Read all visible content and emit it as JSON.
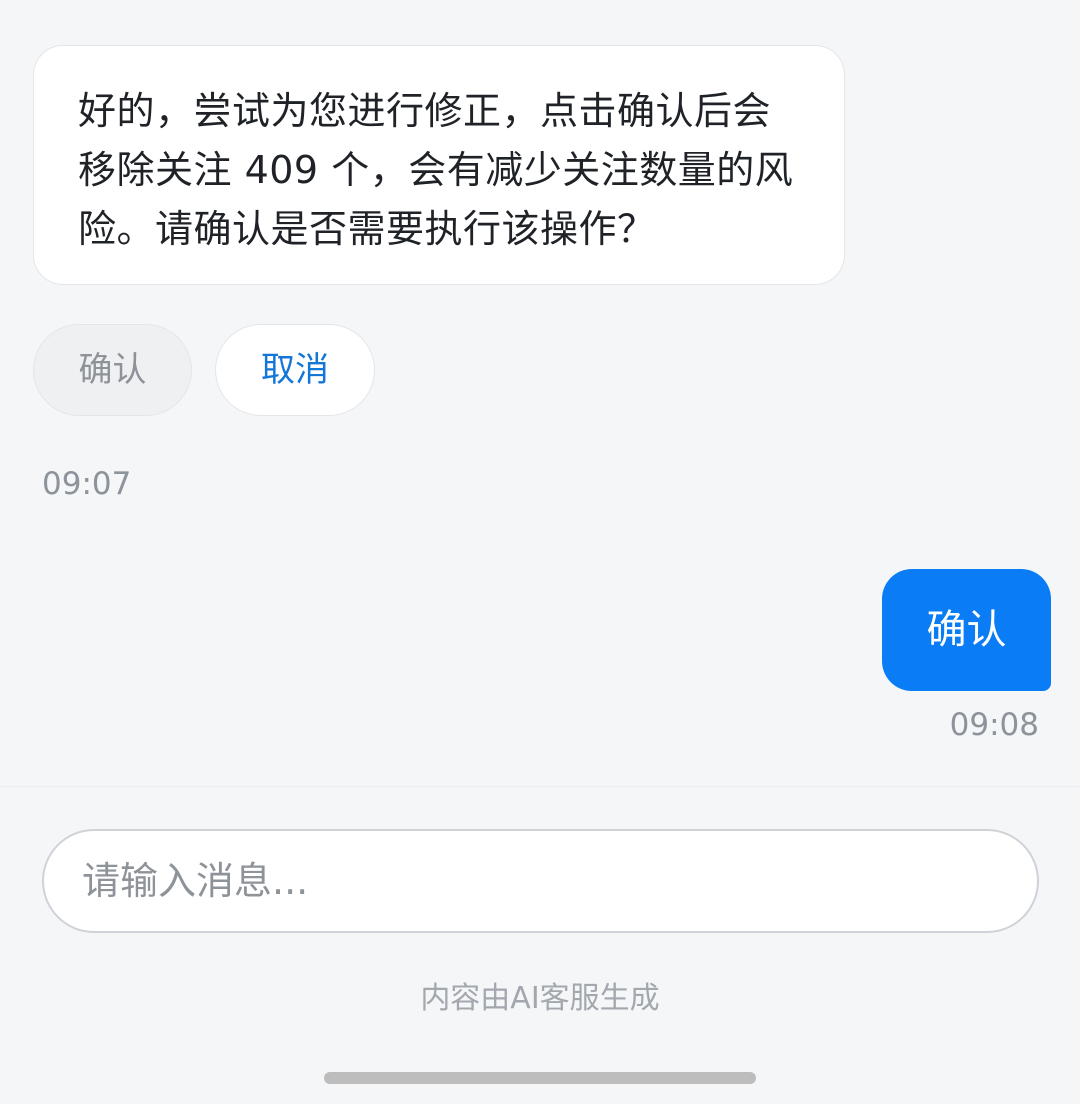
{
  "messages": {
    "bot_text": "好的，尝试为您进行修正，点击确认后会移除关注 409 个，会有减少关注数量的风险。请确认是否需要执行该操作？",
    "quick_replies": {
      "confirm_label": "确认",
      "cancel_label": "取消"
    },
    "bot_time": "09:07",
    "user_text": "确认",
    "user_time": "09:08"
  },
  "input": {
    "placeholder": "请输入消息...",
    "value": ""
  },
  "footer": {
    "disclaimer": "内容由AI客服生成"
  },
  "colors": {
    "accent": "#0a7cf6",
    "cancel_text": "#1476d6",
    "background": "#f5f6f8"
  }
}
